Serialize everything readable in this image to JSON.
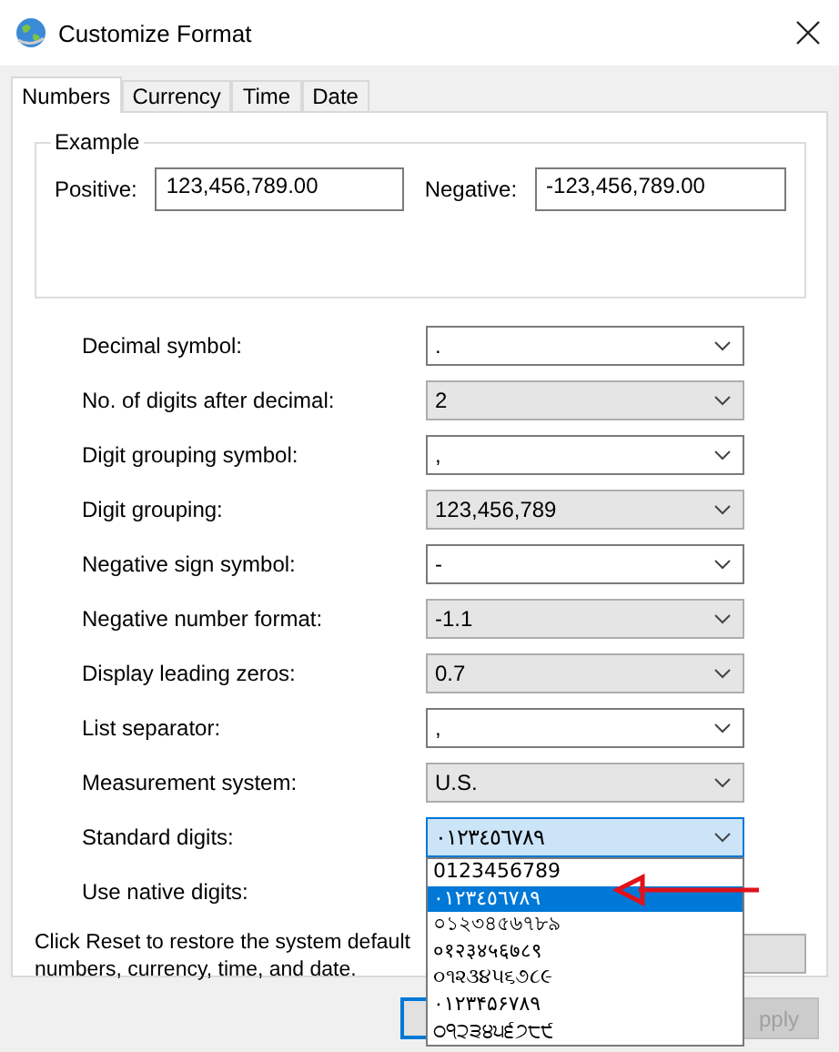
{
  "window": {
    "title": "Customize Format"
  },
  "tabs": [
    {
      "label": "Numbers",
      "selected": true
    },
    {
      "label": "Currency",
      "selected": false
    },
    {
      "label": "Time",
      "selected": false
    },
    {
      "label": "Date",
      "selected": false
    }
  ],
  "example": {
    "legend": "Example",
    "positive_label": "Positive:",
    "positive_value": "123,456,789.00",
    "negative_label": "Negative:",
    "negative_value": "-123,456,789.00"
  },
  "settings": [
    {
      "label": "Decimal symbol:",
      "value": ".",
      "kind": "editable",
      "open": false
    },
    {
      "label": "No. of digits after decimal:",
      "value": "2",
      "kind": "list",
      "open": false
    },
    {
      "label": "Digit grouping symbol:",
      "value": ",",
      "kind": "editable",
      "open": false
    },
    {
      "label": "Digit grouping:",
      "value": "123,456,789",
      "kind": "list",
      "open": false
    },
    {
      "label": "Negative sign symbol:",
      "value": "-",
      "kind": "editable",
      "open": false
    },
    {
      "label": "Negative number format:",
      "value": "-1.1",
      "kind": "list",
      "open": false
    },
    {
      "label": "Display leading zeros:",
      "value": "0.7",
      "kind": "list",
      "open": false
    },
    {
      "label": "List separator:",
      "value": ",",
      "kind": "editable",
      "open": false
    },
    {
      "label": "Measurement system:",
      "value": "U.S.",
      "kind": "list",
      "open": false
    },
    {
      "label": "Standard digits:",
      "value": "٠١٢٣٤٥٦٧٨٩",
      "kind": "list",
      "open": true,
      "options": [
        {
          "label": "0123456789",
          "selected": false
        },
        {
          "label": "٠١٢٣٤٥٦٧٨٩",
          "selected": true
        },
        {
          "label": "০১২৩৪৫৬৭৮৯",
          "selected": false
        },
        {
          "label": "०१२३४५६७८९",
          "selected": false
        },
        {
          "label": "૦૧૨૩૪૫૬૭૮૯",
          "selected": false
        },
        {
          "label": "۰۱۲۳۴۵۶۷۸۹",
          "selected": false
        },
        {
          "label": "੦੧੨੩੪੫੬੭੮੯",
          "selected": false
        }
      ]
    },
    {
      "label": "Use native digits:",
      "kind": "hidden"
    }
  ],
  "reset_note_lines": [
    "Click Reset to restore the system default",
    "numbers, currency, time, and date."
  ],
  "buttons": [
    {
      "kind": "default"
    },
    {
      "label": "pply",
      "kind": "disabled"
    }
  ]
}
